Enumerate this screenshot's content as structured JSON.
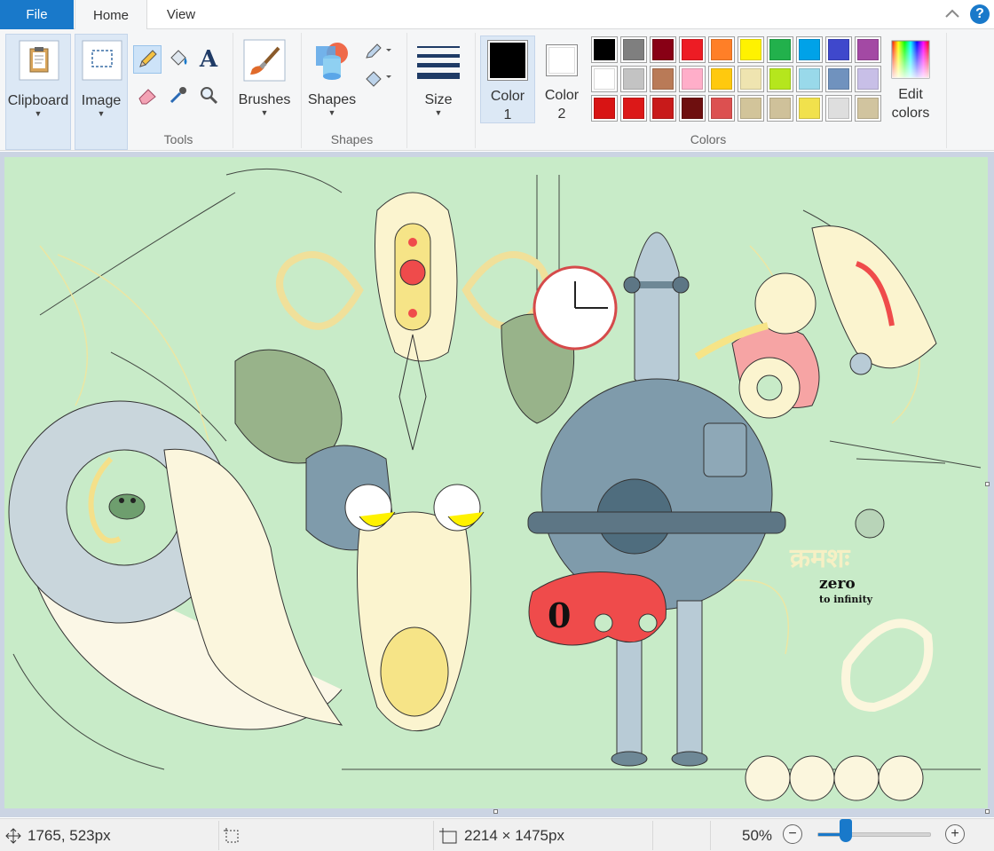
{
  "tabs": {
    "file": "File",
    "home": "Home",
    "view": "View"
  },
  "help": "?",
  "ribbon": {
    "clipboard": "Clipboard",
    "image": "Image",
    "tools_group": "Tools",
    "brushes": "Brushes",
    "shapes": "Shapes",
    "shapes_group": "Shapes",
    "size": "Size",
    "color1_line1": "Color",
    "color1_line2": "1",
    "color2_line1": "Color",
    "color2_line2": "2",
    "colors_group": "Colors",
    "edit_colors_line1": "Edit",
    "edit_colors_line2": "colors",
    "text_tool": "A"
  },
  "palette": {
    "color1": "#000000",
    "color2": "#ffffff",
    "row1": [
      "#000000",
      "#7f7f7f",
      "#880015",
      "#ed1c24",
      "#ff7f27",
      "#fff200",
      "#22b14c",
      "#00a2e8",
      "#3f48cc",
      "#a349a4"
    ],
    "row2": [
      "#ffffff",
      "#c3c3c3",
      "#b97a57",
      "#ffaec9",
      "#ffc90e",
      "#efe4b0",
      "#b5e61d",
      "#99d9ea",
      "#7092be",
      "#c8bfe7"
    ],
    "row3": [
      "#d81414",
      "#dc1818",
      "#c81a1a",
      "#6e0f0f",
      "#dc5050",
      "#d2c49a",
      "#cfc19a",
      "#f1e14c",
      "#dedede",
      "#d1c49f"
    ]
  },
  "artwork": {
    "title_devanagari": "क्रमशः",
    "title_main": "zero",
    "subtitle": "to infinity",
    "digit": "0",
    "colors": {
      "background": "#c8ebc8",
      "slate": "#7f9bab",
      "cream": "#fbf4cf",
      "yellow": "#f6e487",
      "red": "#ef4b4b",
      "sage": "#98b38a"
    }
  },
  "status": {
    "cursor_pos": "1765, 523px",
    "image_size": "2214 × 1475px",
    "zoom": "50%",
    "zoom_fraction": 0.25
  },
  "icons": [
    "move-icon",
    "selection-size-icon",
    "image-size-icon",
    "zoom-out-icon",
    "zoom-in-icon"
  ]
}
